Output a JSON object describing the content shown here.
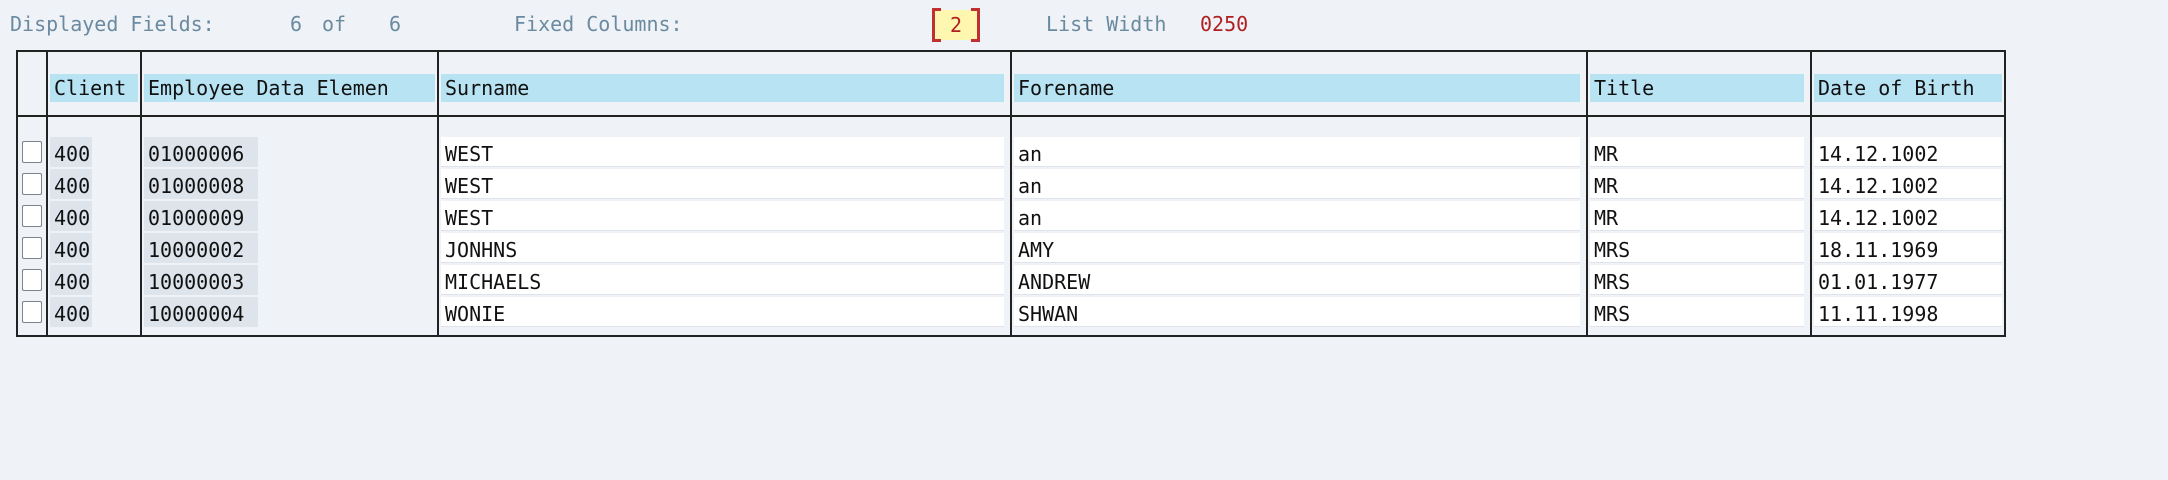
{
  "header": {
    "displayed_fields_label": "Displayed Fields:",
    "displayed_count": "6",
    "of_label": "of",
    "total_count": "6",
    "fixed_columns_label": "Fixed Columns:",
    "fixed_columns_value": "2",
    "list_width_label": "List Width",
    "list_width_value": "0250"
  },
  "table": {
    "columns": [
      "Client",
      "Employee Data Elemen",
      "Surname",
      "Forename",
      "Title",
      "Date of Birth"
    ],
    "rows": [
      {
        "client": "400",
        "employee": "01000006",
        "surname": "WEST",
        "forename": "an",
        "title": "MR",
        "dob": "14.12.1002"
      },
      {
        "client": "400",
        "employee": "01000008",
        "surname": "WEST",
        "forename": "an",
        "title": "MR",
        "dob": "14.12.1002"
      },
      {
        "client": "400",
        "employee": "01000009",
        "surname": "WEST",
        "forename": "an",
        "title": "MR",
        "dob": "14.12.1002"
      },
      {
        "client": "400",
        "employee": "10000002",
        "surname": "JONHNS",
        "forename": "AMY",
        "title": "MRS",
        "dob": "18.11.1969"
      },
      {
        "client": "400",
        "employee": "10000003",
        "surname": "MICHAELS",
        "forename": "ANDREW",
        "title": "MRS",
        "dob": "01.01.1977"
      },
      {
        "client": "400",
        "employee": "10000004",
        "surname": "WONIE",
        "forename": "SHWAN",
        "title": "MRS",
        "dob": "11.11.1998"
      }
    ]
  }
}
